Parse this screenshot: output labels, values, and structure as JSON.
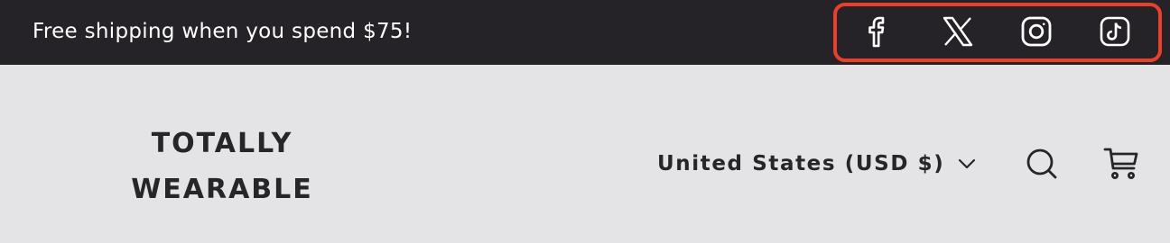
{
  "announcement": {
    "text": "Free shipping when you spend $75!"
  },
  "social": {
    "items": [
      {
        "name": "Facebook",
        "icon": "facebook-icon"
      },
      {
        "name": "X",
        "icon": "x-icon"
      },
      {
        "name": "Instagram",
        "icon": "instagram-icon"
      },
      {
        "name": "TikTok",
        "icon": "tiktok-icon"
      }
    ],
    "highlight_color": "#e8402a"
  },
  "brand": {
    "line1": "TOTALLY",
    "line2": "WEARABLE"
  },
  "localization": {
    "country_label": "United States (USD $)",
    "icon": "chevron-down-icon"
  },
  "header_actions": {
    "search_icon": "search-icon",
    "cart_icon": "cart-icon"
  },
  "colors": {
    "announcement_bg": "#252328",
    "header_bg": "#e4e4e6",
    "text_dark": "#27252a",
    "text_light": "#ffffff"
  }
}
